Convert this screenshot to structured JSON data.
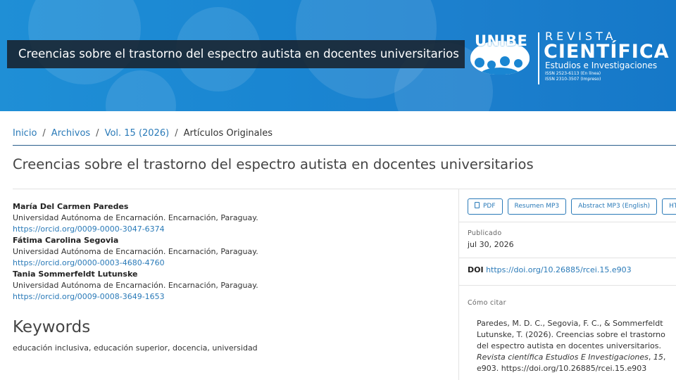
{
  "header": {
    "article_title": "Creencias sobre el trastorno del espectro autista en docentes universitarios",
    "logo": {
      "brand": "UNIBE",
      "revista": "REVISTA",
      "cientifica": "CIENTÍFICA",
      "subtitle": "Estudios e Investigaciones",
      "issn_online": "ISSN 2523-6113 (En línea)",
      "issn_print": "ISSN 2310-3507 (Impreso)"
    },
    "colors": {
      "banner": "#1a86d2",
      "title_bar": "#18222e"
    }
  },
  "breadcrumb": [
    {
      "label": "Inicio"
    },
    {
      "label": "Archivos"
    },
    {
      "label": "Vol. 15 (2026)"
    },
    {
      "label": "Artículos Originales"
    }
  ],
  "page_title": "Creencias sobre el trastorno del espectro autista en docentes universitarios",
  "authors": [
    {
      "name": "María Del Carmen Paredes",
      "affiliation": "Universidad Autónoma de Encarnación. Encarnación, Paraguay.",
      "orcid": "https://orcid.org/0009-0000-3047-6374"
    },
    {
      "name": "Fátima Carolina Segovia",
      "affiliation": "Universidad Autónoma de Encarnación. Encarnación, Paraguay.",
      "orcid": "https://orcid.org/0000-0003-4680-4760"
    },
    {
      "name": "Tania Sommerfeldt Lutunske",
      "affiliation": "Universidad Autónoma de Encarnación. Encarnación, Paraguay.",
      "orcid": "https://orcid.org/0009-0008-3649-1653"
    }
  ],
  "keywords": {
    "title": "Keywords",
    "list": "educación inclusiva, educación superior, docencia, universidad"
  },
  "sidebar": {
    "galleys": [
      {
        "label": "PDF",
        "icon": "file-pdf-icon"
      },
      {
        "label": "Resumen MP3"
      },
      {
        "label": "Abstract MP3 (English)"
      },
      {
        "label": "HTML"
      }
    ],
    "published_label": "Publicado",
    "published_date": "jul 30, 2026",
    "doi_label": "DOI",
    "doi_url": "https://doi.org/10.26885/rcei.15.e903",
    "cite_label": "Cómo citar",
    "citation": {
      "authors_year_title": "Paredes, M. D. C., Segovia, F. C., & Sommerfeldt Lutunske, T. (2026). Creencias sobre el trastorno del espectro autista en docentes universitarios. ",
      "journal": "Revista científica Estudios E Investigaciones",
      "volume": "15",
      "article": "e903.",
      "doi": "https://doi.org/10.26885/rcei.15.e903"
    }
  }
}
